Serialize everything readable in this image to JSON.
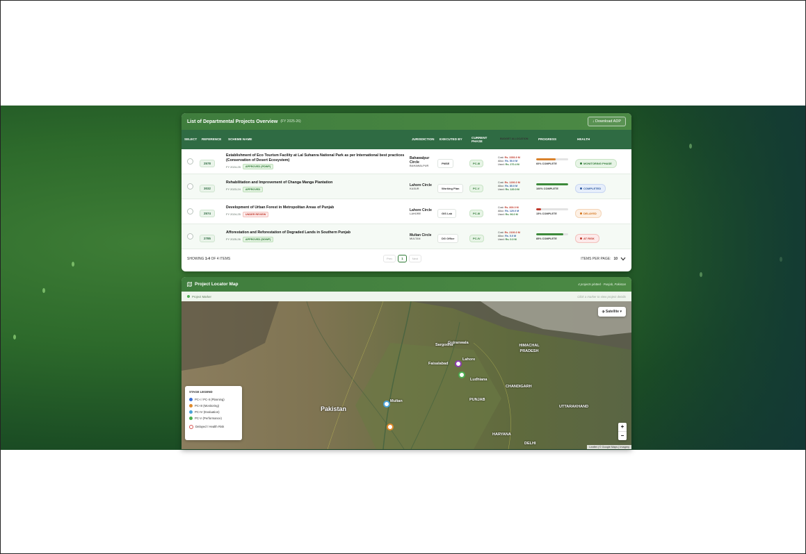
{
  "table": {
    "title": "List of Departmental Projects Overview",
    "subtitle": "(FY 2025-26)",
    "download_label": "↓ Download ADP",
    "columns": {
      "select": "SELECT",
      "reference": "REFERENCE",
      "scheme": "SCHEME NAME",
      "jurisdiction": "JURISDICTION",
      "executed_by": "EXECUTED BY",
      "phase": "CURRENT PHASE",
      "budget": "BUDGET ALLOCATION",
      "progress": "PROGRESS",
      "health": "HEALTH"
    },
    "rows": [
      {
        "ref": "2578",
        "name": "Establishment of Eco Tourism Facility at Lal Suhanra National Park as per International best practices (Conservation of Desert Ecosystem)",
        "fy": "FY 2024-25",
        "status": "APPROVED (PDWP)",
        "jurisdiction": "Bahawalpur Circle",
        "jurisdiction_sub": "BAHAWALPUR",
        "executed_by": "PMSE",
        "phase": "PC-III",
        "cost": "Rs. 3353.9 M",
        "alloc": "Rs. 50.0 M",
        "used": "Rs. 270.4 M",
        "progress": 60,
        "progress_label": "60% COMPLETE",
        "progress_color": "#d9822b",
        "health": "MONITORING PHASE",
        "health_kind": "mon"
      },
      {
        "ref": "3032",
        "name": "Rehabilitation and Improvement of Changa Manga Plantation",
        "fy": "FY 2023-24",
        "status": "APPROVED",
        "jurisdiction": "Lahore Circle",
        "jurisdiction_sub": "KASUR",
        "executed_by": "Working Plan",
        "phase": "PC-V",
        "cost": "Rs. 1200.0 M",
        "alloc": "Rs. 80.0 M",
        "used": "Rs. 120.0 M",
        "progress": 100,
        "progress_label": "100% COMPLETE",
        "progress_color": "#3c8a3a",
        "health": "COMPLETED",
        "health_kind": "comp"
      },
      {
        "ref": "2574",
        "name": "Development of Urban Forest in Metropolitan Areas of Punjab",
        "fy": "FY 2024-25",
        "status": "UNDER REVIEW",
        "jurisdiction": "Lahore Circle",
        "jurisdiction_sub": "LAHORE",
        "executed_by": "GIS Lab",
        "phase": "PC-III",
        "cost": "Rs. 800.0 M",
        "alloc": "Rs. 120.0 M",
        "used": "Rs. 96.0 M",
        "progress": 15,
        "progress_label": "15% COMPLETE",
        "progress_color": "#c0392b",
        "health": "DELAYED",
        "health_kind": "del"
      },
      {
        "ref": "2785",
        "name": "Afforestation and Reforestation of Degraded Lands in Southern Punjab",
        "fy": "FY 2025-26",
        "status": "APPROVED (DDWP)",
        "jurisdiction": "Multan Circle",
        "jurisdiction_sub": "MULTAN",
        "executed_by": "DG Office",
        "phase": "PC-IV",
        "cost": "Rs. 2100.0 M",
        "alloc": "Rs. 0.0 M",
        "used": "Rs. 0.0 M",
        "progress": 85,
        "progress_label": "85% COMPLETE",
        "progress_color": "#3c8a3a",
        "health": "AT RISK",
        "health_kind": "risk"
      }
    ],
    "budget_labels": {
      "cost": "Cost:",
      "alloc": "Alloc:",
      "used": "Used:"
    },
    "showing_prefix": "SHOWING",
    "showing_range": "1-4",
    "showing_suffix": "OF 4 ITEMS",
    "prev_label": "Prev",
    "page": "1",
    "next_label": "Next",
    "items_per_page_label": "ITEMS PER PAGE:",
    "items_per_page": "10"
  },
  "map": {
    "title": "Project Locator Map",
    "plotted": "4 projects plotted · Punjab, Pakistan",
    "marker_label": "Project Marker",
    "hint": "Click a marker to view project details",
    "layer_label": "Satellite",
    "legend_title": "STAGE LEGEND",
    "legend": [
      {
        "label": "PC-I / PC-II (Planning)",
        "color": "#3b6fd6"
      },
      {
        "label": "PC-III (Monitoring)",
        "color": "#e08a2a"
      },
      {
        "label": "PC-IV (Evaluation)",
        "color": "#4aa3d8"
      },
      {
        "label": "PC-V (Performance)",
        "color": "#4caf50"
      },
      {
        "label": "Delayed / Health Risk",
        "color": "#d9534f"
      }
    ],
    "place_labels": [
      "Pakistan",
      "Multan",
      "Lahore",
      "Faisalabad",
      "Gujranwala",
      "HIMACHAL PRADESH",
      "CHANDIGARH",
      "PUNJAB",
      "UTTARAKHAND",
      "HARYANA",
      "DELHI",
      "Ludhiana",
      "Sargodha"
    ],
    "zoom_in": "+",
    "zoom_out": "−",
    "attribution": "Leaflet | © Google Maps | Imagery"
  }
}
